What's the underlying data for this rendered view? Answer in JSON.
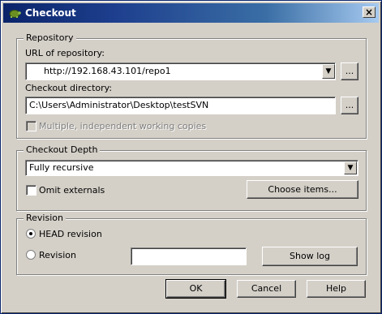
{
  "window": {
    "title": "Checkout",
    "close_glyph": "×"
  },
  "repository": {
    "group_label": "Repository",
    "url_label": "URL of repository:",
    "url_value": "http://192.168.43.101/repo1",
    "browse_label": "...",
    "dir_label": "Checkout directory:",
    "dir_value": "C:\\Users\\Administrator\\Desktop\\testSVN",
    "dir_browse_label": "...",
    "multiple_wc_label": "Multiple, independent working copies",
    "multiple_wc_checked": false
  },
  "depth": {
    "group_label": "Checkout Depth",
    "selected": "Fully recursive",
    "omit_externals_label": "Omit externals",
    "omit_externals_checked": false,
    "choose_items_label": "Choose items..."
  },
  "revision": {
    "group_label": "Revision",
    "head_label": "HEAD revision",
    "revision_label": "Revision",
    "selected": "HEAD revision",
    "revision_value": "",
    "show_log_label": "Show log"
  },
  "buttons": {
    "ok": "OK",
    "cancel": "Cancel",
    "help": "Help"
  },
  "icons": {
    "title_icon": "tortoise-icon",
    "dropdown_icon": "chevron-down-icon"
  }
}
